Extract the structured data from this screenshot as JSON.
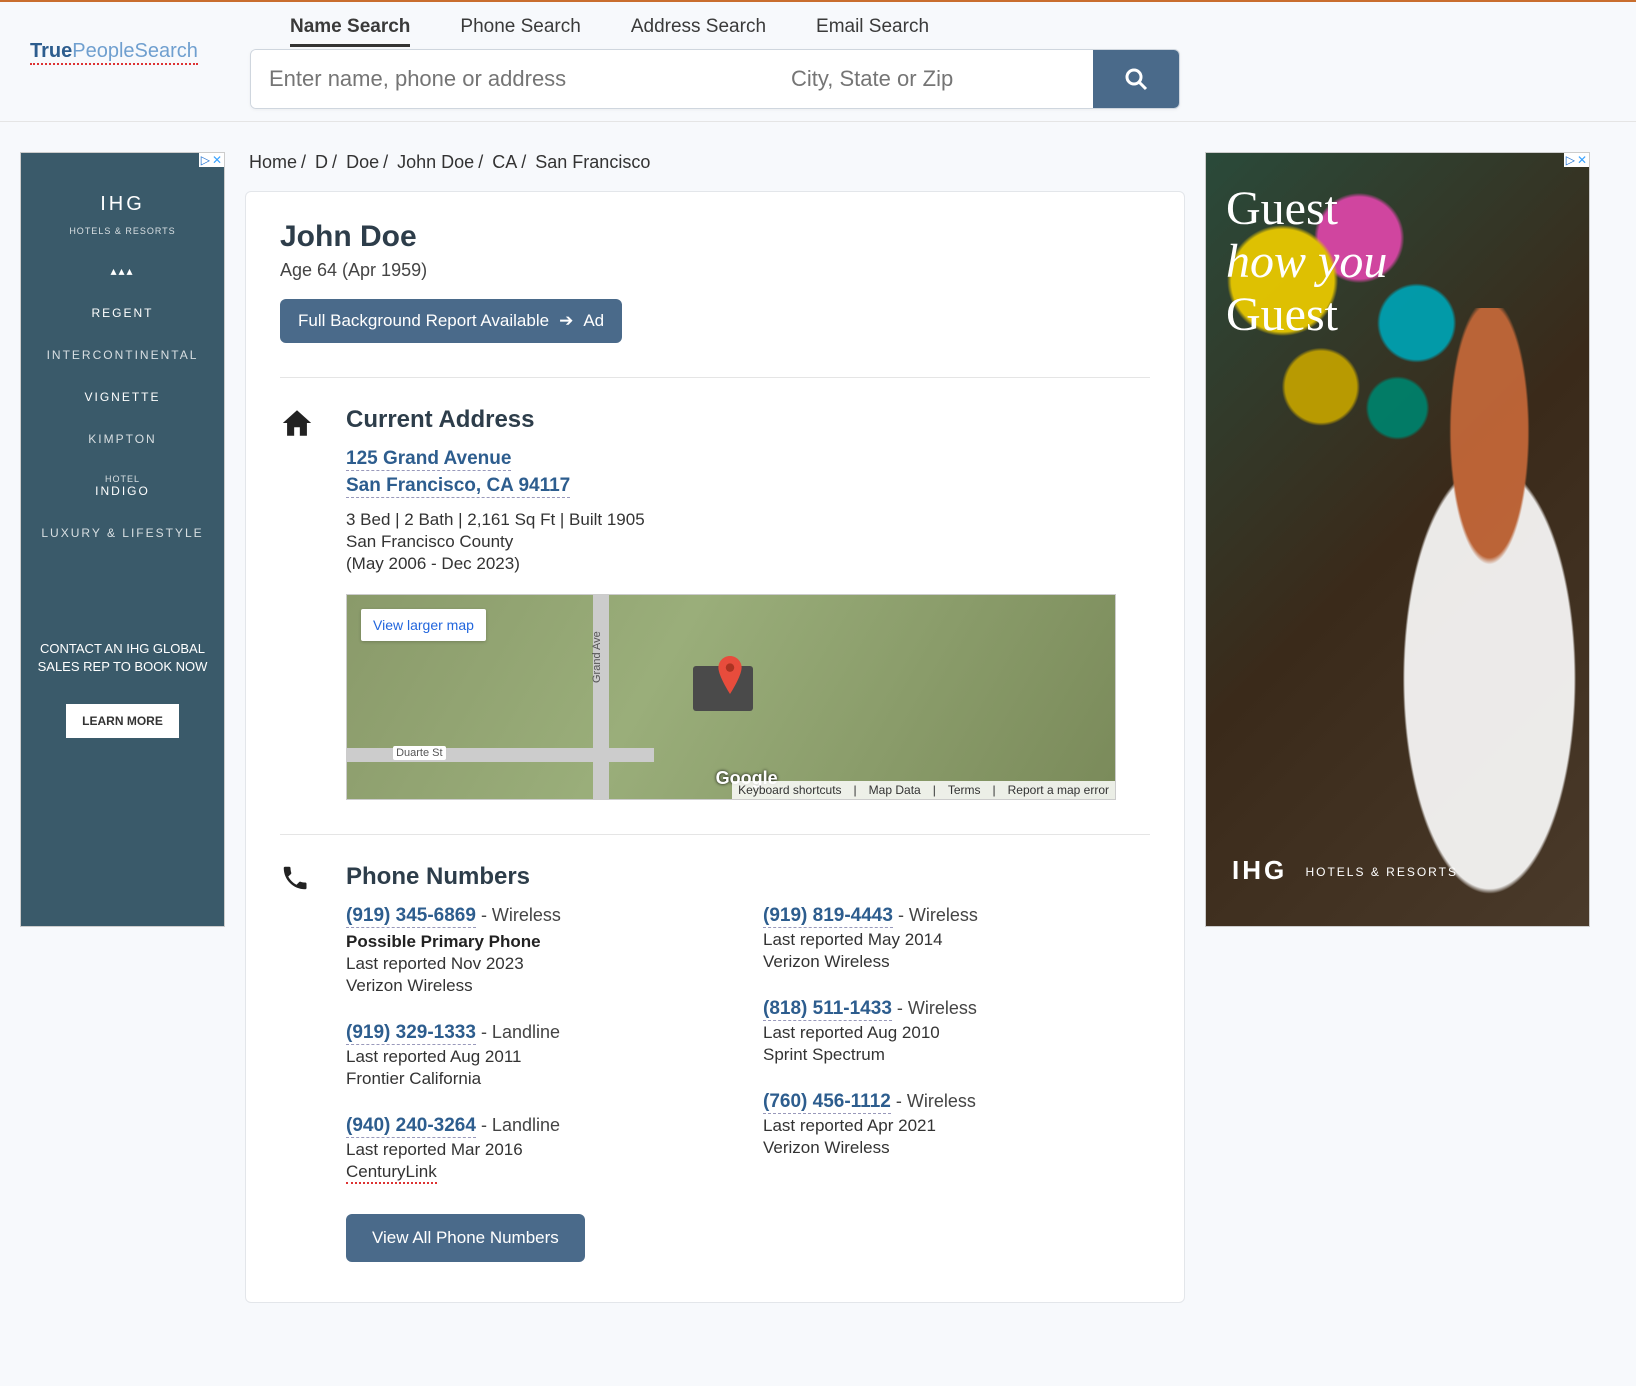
{
  "logo": {
    "part1": "True",
    "part2": "PeopleSearch"
  },
  "search": {
    "tabs": [
      "Name Search",
      "Phone Search",
      "Address Search",
      "Email Search"
    ],
    "active_tab": 0,
    "placeholder_main": "Enter name, phone or address",
    "placeholder_loc": "City, State or Zip"
  },
  "breadcrumb": [
    "Home",
    "D",
    "Doe",
    "John Doe",
    "CA",
    "San Francisco"
  ],
  "person": {
    "name": "John Doe",
    "age_line": "Age 64 (Apr 1959)"
  },
  "bg_report": {
    "label": "Full Background Report Available",
    "suffix": "Ad"
  },
  "sections": {
    "address": {
      "title": "Current Address",
      "street": "125 Grand Avenue",
      "citystate": "San Francisco, CA 94117",
      "details": "3 Bed | 2 Bath | 2,161 Sq Ft | Built 1905",
      "county": "San Francisco County",
      "dates": "(May 2006 - Dec 2023)",
      "map": {
        "view_larger": "View larger map",
        "streets": {
          "grand": "Grand Ave",
          "duarte": "Duarte St"
        },
        "logo": "Google",
        "footer": [
          "Keyboard shortcuts",
          "Map Data",
          "Terms",
          "Report a map error"
        ]
      }
    },
    "phones": {
      "title": "Phone Numbers",
      "left": [
        {
          "number": "(919) 345-6869",
          "type": "Wireless",
          "primary": "Possible Primary Phone",
          "reported": "Last reported Nov 2023",
          "carrier": "Verizon Wireless"
        },
        {
          "number": "(919) 329-1333",
          "type": "Landline",
          "reported": "Last reported Aug 2011",
          "carrier": "Frontier California"
        },
        {
          "number": "(940) 240-3264",
          "type": "Landline",
          "reported": "Last reported Mar 2016",
          "carrier": "CenturyLink",
          "squiggle": true
        }
      ],
      "right": [
        {
          "number": "(919) 819-4443",
          "type": "Wireless",
          "reported": "Last reported May 2014",
          "carrier": "Verizon Wireless"
        },
        {
          "number": "(818) 511-1433",
          "type": "Wireless",
          "reported": "Last reported Aug 2010",
          "carrier": "Sprint Spectrum"
        },
        {
          "number": "(760) 456-1112",
          "type": "Wireless",
          "reported": "Last reported Apr 2021",
          "carrier": "Verizon Wireless"
        }
      ],
      "view_all": "View All Phone Numbers"
    }
  },
  "ads": {
    "left": {
      "brand": "IHG",
      "brand_sub": "HOTELS & RESORTS",
      "items": [
        "REGENT",
        "INTERCONTINENTAL",
        "VIGNETTE",
        "KIMPTON",
        "INDIGO"
      ],
      "pre_indigo": "HOTEL",
      "tail": "LUXURY & LIFESTYLE",
      "cta_text": "CONTACT AN IHG GLOBAL SALES REP TO BOOK NOW",
      "cta_btn": "LEARN MORE"
    },
    "right": {
      "headline1": "Guest",
      "headline2": "how you",
      "headline3": "Guest",
      "brand": "IHG",
      "brand_sub": "HOTELS & RESORTS"
    }
  }
}
